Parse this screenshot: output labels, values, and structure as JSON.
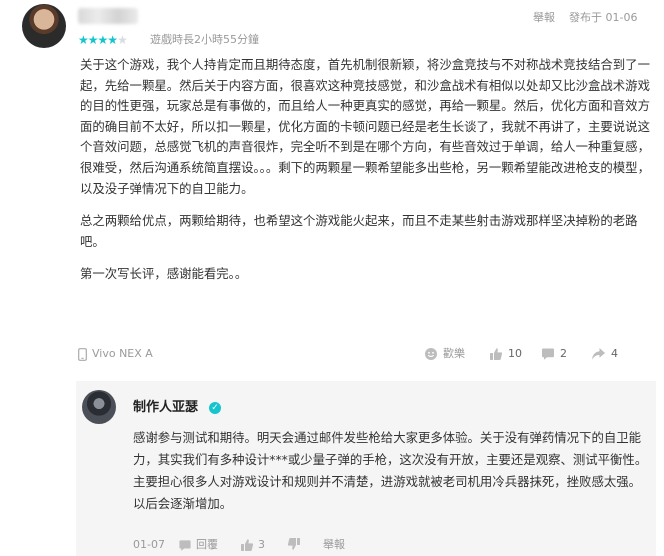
{
  "review": {
    "rating": 4,
    "rating_max": 5,
    "playtime": "遊戲時長2小時55分鐘",
    "report_label": "舉報",
    "published": "發布于 01-06",
    "paragraphs": [
      "关于这个游戏，我个人持肯定而且期待态度，首先机制很新颖，将沙盒竞技与不对称战术竞技结合到了一起，先给一颗星。然后关于内容方面，很喜欢这种竞技感觉，和沙盒战术有相似以处却又比沙盒战术游戏的目的性更强，玩家总是有事做的，而且给人一种更真实的感觉，再给一颗星。然后，优化方面和音效方面的确目前不太好，所以扣一颗星，优化方面的卡顿问题已经是老生长谈了，我就不再讲了，主要说说这个音效问题，总感觉飞机的声音很炸，完全听不到是在哪个方向，有些音效过于单调，给人一种重复感，很难受，然后沟通系统简直摆设。。。剩下的两颗星一颗希望能多出些枪，另一颗希望能改进枪支的模型，以及没子弹情况下的自卫能力。",
      "总之两颗给优点，两颗给期待，也希望这个游戏能火起来，而且不走某些射击游戏那样坚决掉粉的老路吧。",
      "第一次写长评，感谢能看完。。"
    ],
    "device": "Vivo NEX A",
    "dislike_label": "歡樂",
    "likes": "10",
    "comments": "2",
    "shares": "4"
  },
  "reply": {
    "author": "制作人亚瑟",
    "text": "感谢参与测试和期待。明天会通过邮件发些枪给大家更多体验。关于没有弹药情况下的自卫能力，其实我们有多种设计***或少量子弹的手枪，这次没有开放，主要还是观察、测试平衡性。主要担心很多人对游戏设计和规则并不清楚，进游戏就被老司机用冷兵器抹死，挫败感太强。以后会逐渐增加。",
    "date": "01-07",
    "reply_label": "回覆",
    "likes": "3",
    "report_label": "舉報"
  },
  "colors": {
    "accent": "#15c5ce",
    "muted": "#9a9a9a",
    "reply_bg": "#f5f5f5"
  }
}
